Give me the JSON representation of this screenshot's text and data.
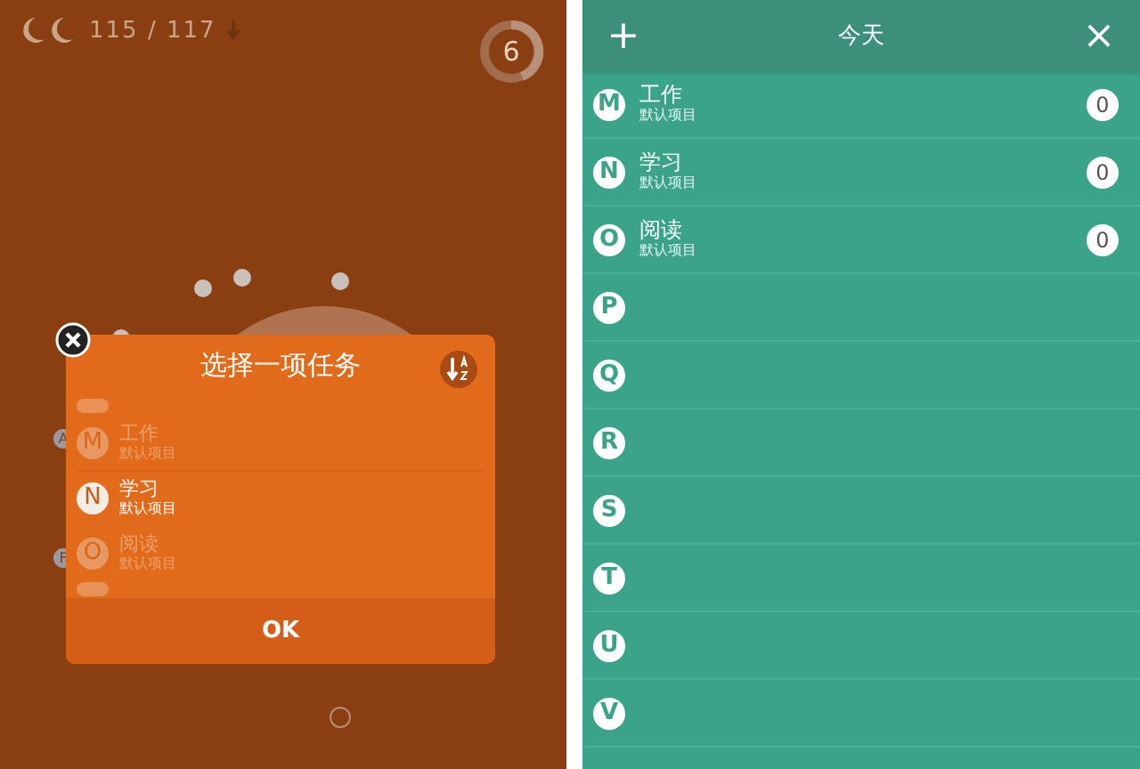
{
  "task_screen": {
    "progress": "115 / 117",
    "timer": "6",
    "orbit_letters": [
      "A",
      "F"
    ],
    "dialog": {
      "title": "选择一项任务",
      "items": [
        {
          "letter": "M",
          "name": "工作",
          "sub": "默认项目",
          "selected": false
        },
        {
          "letter": "N",
          "name": "学习",
          "sub": "默认项目",
          "selected": true
        },
        {
          "letter": "O",
          "name": "阅读",
          "sub": "默认项目",
          "selected": false
        }
      ],
      "ok": "OK"
    }
  },
  "list_screen": {
    "add": "+",
    "title": "今天",
    "close": "×",
    "rows": [
      {
        "letter": "M",
        "name": "工作",
        "sub": "默认项目",
        "count": "0"
      },
      {
        "letter": "N",
        "name": "学习",
        "sub": "默认项目",
        "count": "0"
      },
      {
        "letter": "O",
        "name": "阅读",
        "sub": "默认项目",
        "count": "0"
      },
      {
        "letter": "P"
      },
      {
        "letter": "Q"
      },
      {
        "letter": "R"
      },
      {
        "letter": "S"
      },
      {
        "letter": "T"
      },
      {
        "letter": "U"
      },
      {
        "letter": "V"
      }
    ]
  }
}
